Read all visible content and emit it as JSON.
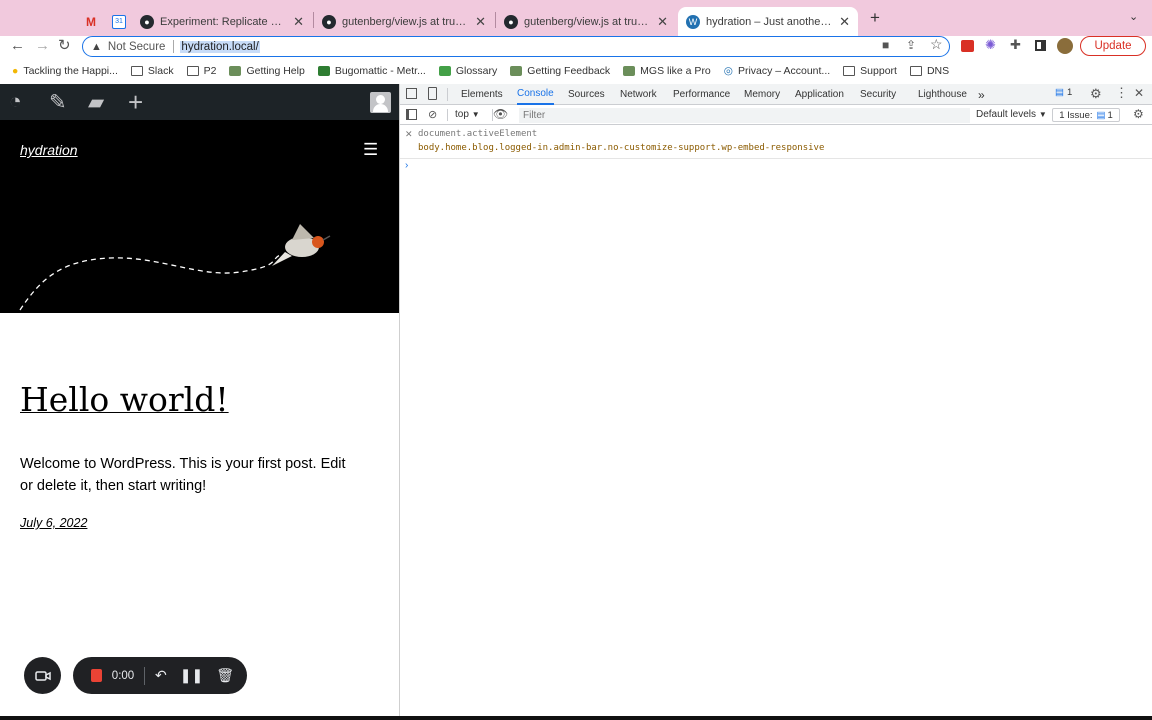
{
  "browser": {
    "tabs": [
      {
        "title": "",
        "favicon": "gmail-icon"
      },
      {
        "title": "",
        "favicon": "calendar-icon"
      },
      {
        "title": "Experiment: Replicate Navigati",
        "favicon": "github-icon"
      },
      {
        "title": "gutenberg/view.js at trunk · W",
        "favicon": "github-icon"
      },
      {
        "title": "gutenberg/view.js at trunk · W",
        "favicon": "github-icon"
      },
      {
        "title": "hydration – Just another Word",
        "favicon": "wordpress-icon",
        "active": true
      }
    ],
    "new_tab": "+",
    "address": {
      "security_label": "Not Secure",
      "url": "hydration.local/"
    },
    "update_label": "Update",
    "bookmarks": [
      {
        "label": "Tackling the Happi...",
        "icon": "lightbulb-icon"
      },
      {
        "label": "Slack",
        "icon": "folder-icon"
      },
      {
        "label": "P2",
        "icon": "folder-icon"
      },
      {
        "label": "Getting Help",
        "icon": "site-icon"
      },
      {
        "label": "Bugomattic - Metr...",
        "icon": "site-icon"
      },
      {
        "label": "Glossary",
        "icon": "site-icon"
      },
      {
        "label": "Getting Feedback",
        "icon": "site-icon"
      },
      {
        "label": "MGS like a Pro",
        "icon": "site-icon"
      },
      {
        "label": "Privacy – Account...",
        "icon": "site-icon"
      },
      {
        "label": "Support",
        "icon": "folder-icon"
      },
      {
        "label": "DNS",
        "icon": "folder-icon"
      }
    ]
  },
  "site": {
    "title": "hydration",
    "post_title": "Hello world!",
    "post_body": "Welcome to WordPress. This is your first post. Edit or delete it, then start writing!",
    "post_date": "July 6, 2022"
  },
  "recorder": {
    "time": "0:00"
  },
  "devtools": {
    "tabs": [
      "Elements",
      "Console",
      "Sources",
      "Network",
      "Performance",
      "Memory",
      "Application",
      "Security",
      "Lighthouse"
    ],
    "active_tab": "Console",
    "messages_badge": "1",
    "context": "top",
    "filter_placeholder": "Filter",
    "levels": "Default levels",
    "issues": "1 Issue:",
    "issues_count": "1",
    "console_input": "document.activeElement",
    "console_output": "body.home.blog.logged-in.admin-bar.no-customize-support.wp-embed-responsive"
  },
  "colors": {
    "accent": "#1a73e8",
    "tabstrip": "#f1c9dd",
    "adminbar": "#1d2327",
    "record": "#ea4335",
    "update": "#d93025"
  }
}
